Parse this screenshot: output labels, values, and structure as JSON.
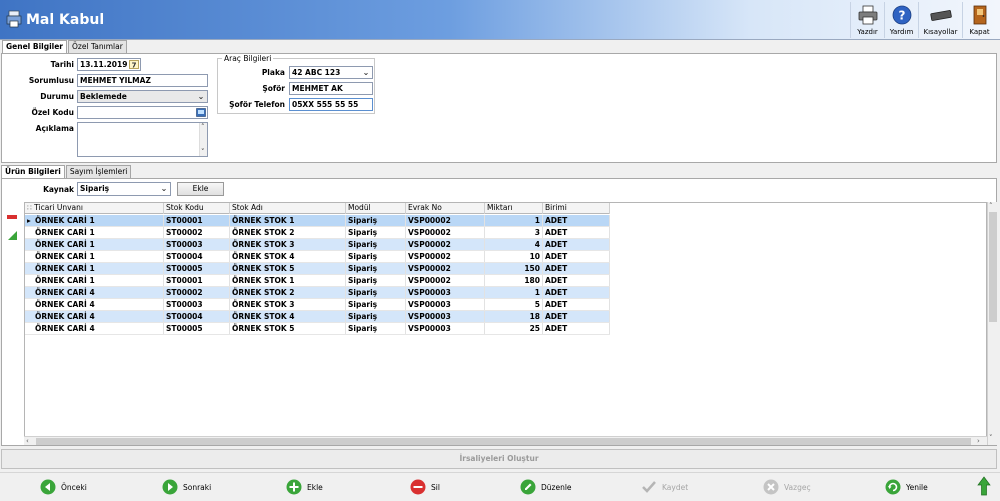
{
  "window": {
    "title": "Mal Kabul"
  },
  "toolbar": {
    "print_label": "Yazdır",
    "help_label": "Yardım",
    "shortcuts_label": "Kısayollar",
    "close_label": "Kapat"
  },
  "top_tabs": [
    {
      "label": "Genel Bilgiler",
      "active": true
    },
    {
      "label": "Özel Tanımlar",
      "active": false
    }
  ],
  "form": {
    "date_label": "Tarihi",
    "date_value": "13.11.2019",
    "responsible_label": "Sorumlusu",
    "responsible_value": "MEHMET YILMAZ",
    "status_label": "Durumu",
    "status_value": "Beklemede",
    "special_code_label": "Özel Kodu",
    "special_code_value": "",
    "description_label": "Açıklama",
    "description_value": ""
  },
  "vehicle": {
    "group_title": "Araç Bilgileri",
    "plate_label": "Plaka",
    "plate_value": "42 ABC 123",
    "driver_label": "Şoför",
    "driver_value": "MEHMET AK",
    "driver_phone_label": "Şoför Telefon",
    "driver_phone_value": "05XX 555 55 55"
  },
  "bottom_tabs": [
    {
      "label": "Ürün Bilgileri",
      "active": true
    },
    {
      "label": "Sayım İşlemleri",
      "active": false
    }
  ],
  "source": {
    "label": "Kaynak",
    "value": "Sipariş",
    "add_label": "Ekle"
  },
  "table": {
    "columns": [
      "Ticari Unvanı",
      "Stok Kodu",
      "Stok Adı",
      "Modül",
      "Evrak No",
      "Miktarı",
      "Birimi"
    ],
    "rows": [
      [
        "ÖRNEK CARİ 1",
        "ST00001",
        "ÖRNEK STOK 1",
        "Sipariş",
        "VSP00002",
        "1",
        "ADET"
      ],
      [
        "ÖRNEK CARİ 1",
        "ST00002",
        "ÖRNEK STOK 2",
        "Sipariş",
        "VSP00002",
        "3",
        "ADET"
      ],
      [
        "ÖRNEK CARİ 1",
        "ST00003",
        "ÖRNEK STOK 3",
        "Sipariş",
        "VSP00002",
        "4",
        "ADET"
      ],
      [
        "ÖRNEK CARİ 1",
        "ST00004",
        "ÖRNEK STOK 4",
        "Sipariş",
        "VSP00002",
        "10",
        "ADET"
      ],
      [
        "ÖRNEK CARİ 1",
        "ST00005",
        "ÖRNEK STOK 5",
        "Sipariş",
        "VSP00002",
        "150",
        "ADET"
      ],
      [
        "ÖRNEK CARİ 1",
        "ST00001",
        "ÖRNEK STOK 1",
        "Sipariş",
        "VSP00002",
        "180",
        "ADET"
      ],
      [
        "ÖRNEK CARİ 4",
        "ST00002",
        "ÖRNEK STOK 2",
        "Sipariş",
        "VSP00003",
        "1",
        "ADET"
      ],
      [
        "ÖRNEK CARİ 4",
        "ST00003",
        "ÖRNEK STOK 3",
        "Sipariş",
        "VSP00003",
        "5",
        "ADET"
      ],
      [
        "ÖRNEK CARİ 4",
        "ST00004",
        "ÖRNEK STOK 4",
        "Sipariş",
        "VSP00003",
        "18",
        "ADET"
      ],
      [
        "ÖRNEK CARİ 4",
        "ST00005",
        "ÖRNEK STOK 5",
        "Sipariş",
        "VSP00003",
        "25",
        "ADET"
      ]
    ]
  },
  "create_dispatch_label": "İrsaliyeleri Oluştur",
  "bottom_buttons": {
    "prev": "Önceki",
    "next": "Sonraki",
    "add": "Ekle",
    "delete": "Sil",
    "edit": "Düzenle",
    "save": "Kaydet",
    "cancel": "Vazgeç",
    "refresh": "Yenile"
  },
  "colors": {
    "header_start": "#3f74c4",
    "row_alt": "#d4e6fa",
    "green": "#3aa53a",
    "red": "#d93030"
  }
}
